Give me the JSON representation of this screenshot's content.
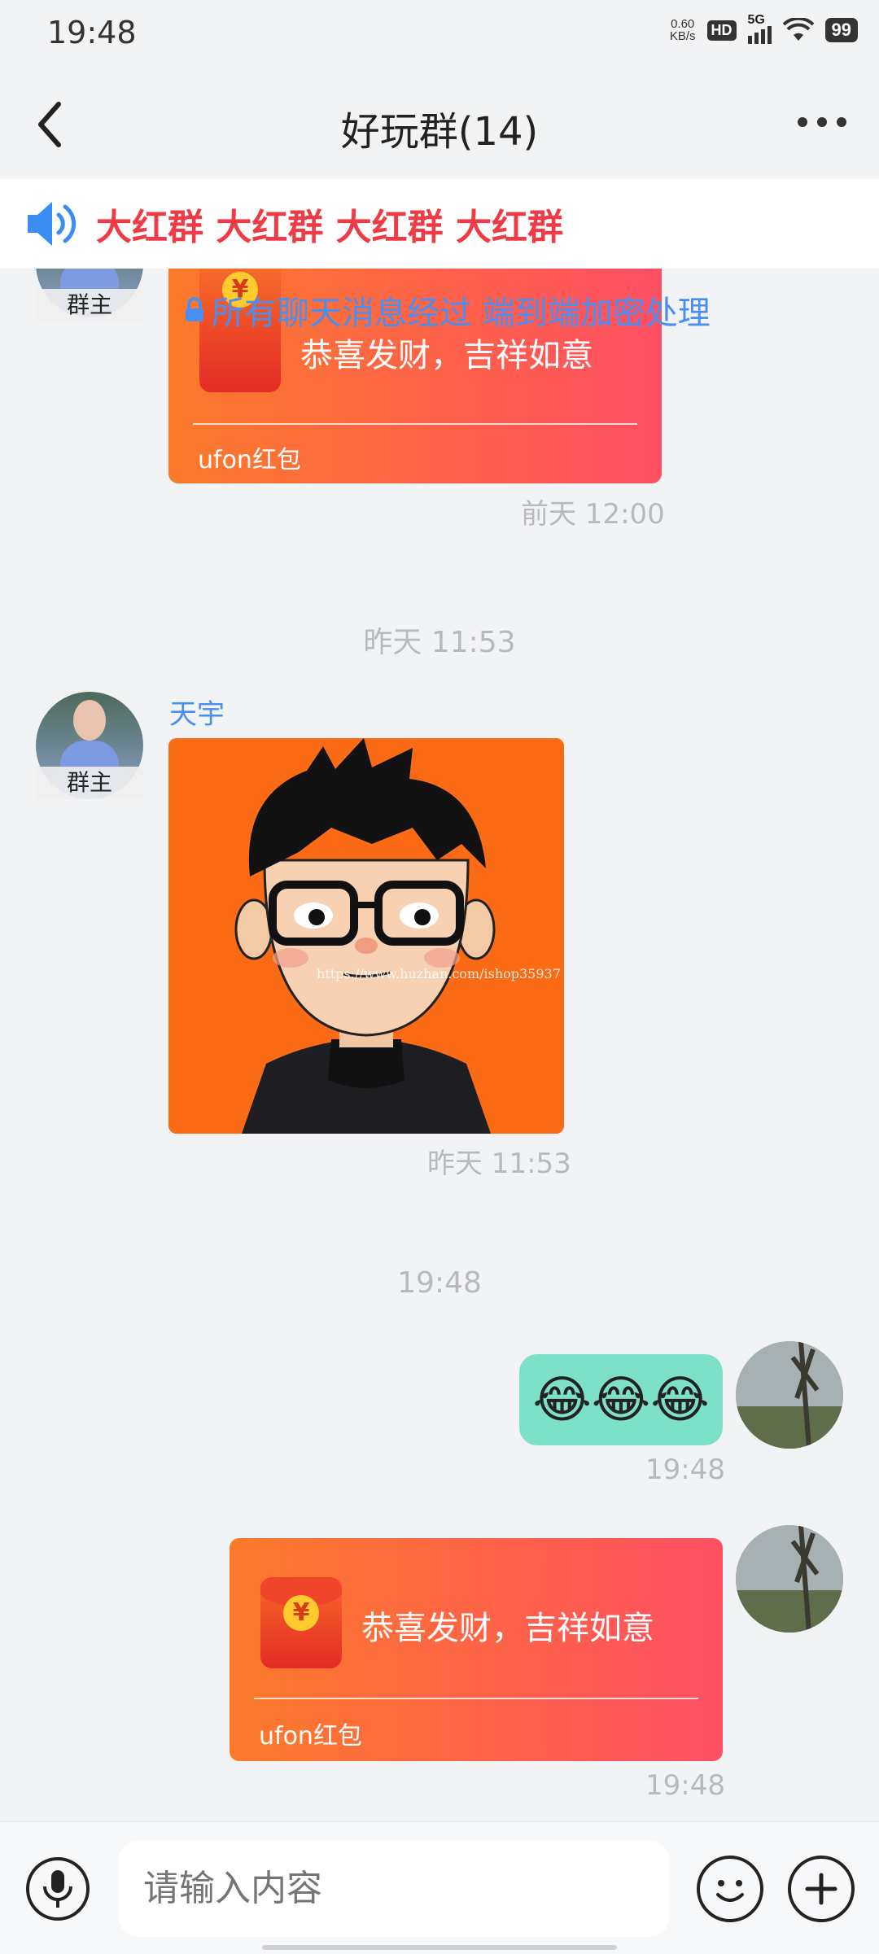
{
  "status_bar": {
    "time": "19:48",
    "net_speed": "0.60",
    "net_unit": "KB/s",
    "hd": "HD",
    "network": "5G",
    "battery": "99"
  },
  "header": {
    "title": "好玩群(14)"
  },
  "notice": {
    "text": "大红群 大红群 大红群 大红群",
    "color": "#ee3b45"
  },
  "encryption_notice": "所有聊天消息经过 端到端加密处理",
  "messages": [
    {
      "owner_badge": "群主",
      "red_packet_text": "恭喜发财，吉祥如意",
      "red_packet_label": "ufon红包",
      "timestamp": "前天 12:00"
    },
    {
      "divider_time": "昨天 11:53",
      "sender": "天宇",
      "owner_badge": "群主",
      "image_watermark": "https://www.huzhan.com/ishop35937",
      "timestamp": "昨天 11:53"
    },
    {
      "divider_time": "19:48",
      "emoji": "😂😂😂",
      "timestamp": "19:48"
    },
    {
      "red_packet_text": "恭喜发财，吉祥如意",
      "red_packet_label": "ufon红包",
      "timestamp": "19:48"
    }
  ],
  "input_bar": {
    "placeholder": "请输入内容"
  },
  "colors": {
    "accent_blue": "#4a8ff0",
    "emoji_bubble": "#7de0c8",
    "red_packet_start": "#fb7a2a",
    "red_packet_end": "#ff4f63"
  }
}
